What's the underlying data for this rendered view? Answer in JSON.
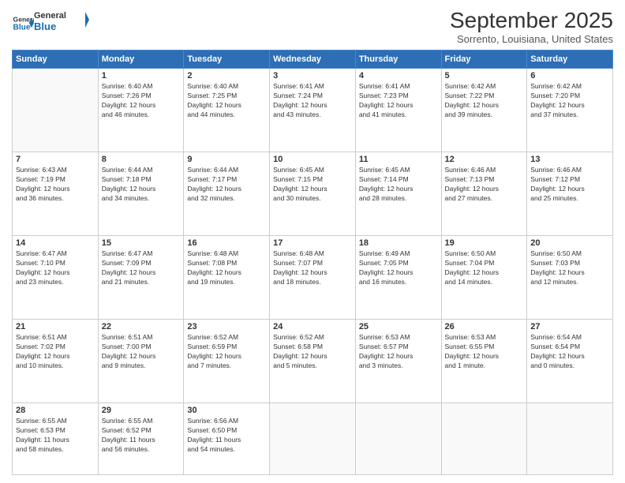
{
  "logo": {
    "line1": "General",
    "line2": "Blue"
  },
  "header": {
    "title": "September 2025",
    "subtitle": "Sorrento, Louisiana, United States"
  },
  "days_of_week": [
    "Sunday",
    "Monday",
    "Tuesday",
    "Wednesday",
    "Thursday",
    "Friday",
    "Saturday"
  ],
  "weeks": [
    [
      {
        "day": "",
        "info": ""
      },
      {
        "day": "1",
        "info": "Sunrise: 6:40 AM\nSunset: 7:26 PM\nDaylight: 12 hours\nand 46 minutes."
      },
      {
        "day": "2",
        "info": "Sunrise: 6:40 AM\nSunset: 7:25 PM\nDaylight: 12 hours\nand 44 minutes."
      },
      {
        "day": "3",
        "info": "Sunrise: 6:41 AM\nSunset: 7:24 PM\nDaylight: 12 hours\nand 43 minutes."
      },
      {
        "day": "4",
        "info": "Sunrise: 6:41 AM\nSunset: 7:23 PM\nDaylight: 12 hours\nand 41 minutes."
      },
      {
        "day": "5",
        "info": "Sunrise: 6:42 AM\nSunset: 7:22 PM\nDaylight: 12 hours\nand 39 minutes."
      },
      {
        "day": "6",
        "info": "Sunrise: 6:42 AM\nSunset: 7:20 PM\nDaylight: 12 hours\nand 37 minutes."
      }
    ],
    [
      {
        "day": "7",
        "info": "Sunrise: 6:43 AM\nSunset: 7:19 PM\nDaylight: 12 hours\nand 36 minutes."
      },
      {
        "day": "8",
        "info": "Sunrise: 6:44 AM\nSunset: 7:18 PM\nDaylight: 12 hours\nand 34 minutes."
      },
      {
        "day": "9",
        "info": "Sunrise: 6:44 AM\nSunset: 7:17 PM\nDaylight: 12 hours\nand 32 minutes."
      },
      {
        "day": "10",
        "info": "Sunrise: 6:45 AM\nSunset: 7:15 PM\nDaylight: 12 hours\nand 30 minutes."
      },
      {
        "day": "11",
        "info": "Sunrise: 6:45 AM\nSunset: 7:14 PM\nDaylight: 12 hours\nand 28 minutes."
      },
      {
        "day": "12",
        "info": "Sunrise: 6:46 AM\nSunset: 7:13 PM\nDaylight: 12 hours\nand 27 minutes."
      },
      {
        "day": "13",
        "info": "Sunrise: 6:46 AM\nSunset: 7:12 PM\nDaylight: 12 hours\nand 25 minutes."
      }
    ],
    [
      {
        "day": "14",
        "info": "Sunrise: 6:47 AM\nSunset: 7:10 PM\nDaylight: 12 hours\nand 23 minutes."
      },
      {
        "day": "15",
        "info": "Sunrise: 6:47 AM\nSunset: 7:09 PM\nDaylight: 12 hours\nand 21 minutes."
      },
      {
        "day": "16",
        "info": "Sunrise: 6:48 AM\nSunset: 7:08 PM\nDaylight: 12 hours\nand 19 minutes."
      },
      {
        "day": "17",
        "info": "Sunrise: 6:48 AM\nSunset: 7:07 PM\nDaylight: 12 hours\nand 18 minutes."
      },
      {
        "day": "18",
        "info": "Sunrise: 6:49 AM\nSunset: 7:05 PM\nDaylight: 12 hours\nand 16 minutes."
      },
      {
        "day": "19",
        "info": "Sunrise: 6:50 AM\nSunset: 7:04 PM\nDaylight: 12 hours\nand 14 minutes."
      },
      {
        "day": "20",
        "info": "Sunrise: 6:50 AM\nSunset: 7:03 PM\nDaylight: 12 hours\nand 12 minutes."
      }
    ],
    [
      {
        "day": "21",
        "info": "Sunrise: 6:51 AM\nSunset: 7:02 PM\nDaylight: 12 hours\nand 10 minutes."
      },
      {
        "day": "22",
        "info": "Sunrise: 6:51 AM\nSunset: 7:00 PM\nDaylight: 12 hours\nand 9 minutes."
      },
      {
        "day": "23",
        "info": "Sunrise: 6:52 AM\nSunset: 6:59 PM\nDaylight: 12 hours\nand 7 minutes."
      },
      {
        "day": "24",
        "info": "Sunrise: 6:52 AM\nSunset: 6:58 PM\nDaylight: 12 hours\nand 5 minutes."
      },
      {
        "day": "25",
        "info": "Sunrise: 6:53 AM\nSunset: 6:57 PM\nDaylight: 12 hours\nand 3 minutes."
      },
      {
        "day": "26",
        "info": "Sunrise: 6:53 AM\nSunset: 6:55 PM\nDaylight: 12 hours\nand 1 minute."
      },
      {
        "day": "27",
        "info": "Sunrise: 6:54 AM\nSunset: 6:54 PM\nDaylight: 12 hours\nand 0 minutes."
      }
    ],
    [
      {
        "day": "28",
        "info": "Sunrise: 6:55 AM\nSunset: 6:53 PM\nDaylight: 11 hours\nand 58 minutes."
      },
      {
        "day": "29",
        "info": "Sunrise: 6:55 AM\nSunset: 6:52 PM\nDaylight: 11 hours\nand 56 minutes."
      },
      {
        "day": "30",
        "info": "Sunrise: 6:56 AM\nSunset: 6:50 PM\nDaylight: 11 hours\nand 54 minutes."
      },
      {
        "day": "",
        "info": ""
      },
      {
        "day": "",
        "info": ""
      },
      {
        "day": "",
        "info": ""
      },
      {
        "day": "",
        "info": ""
      }
    ]
  ]
}
